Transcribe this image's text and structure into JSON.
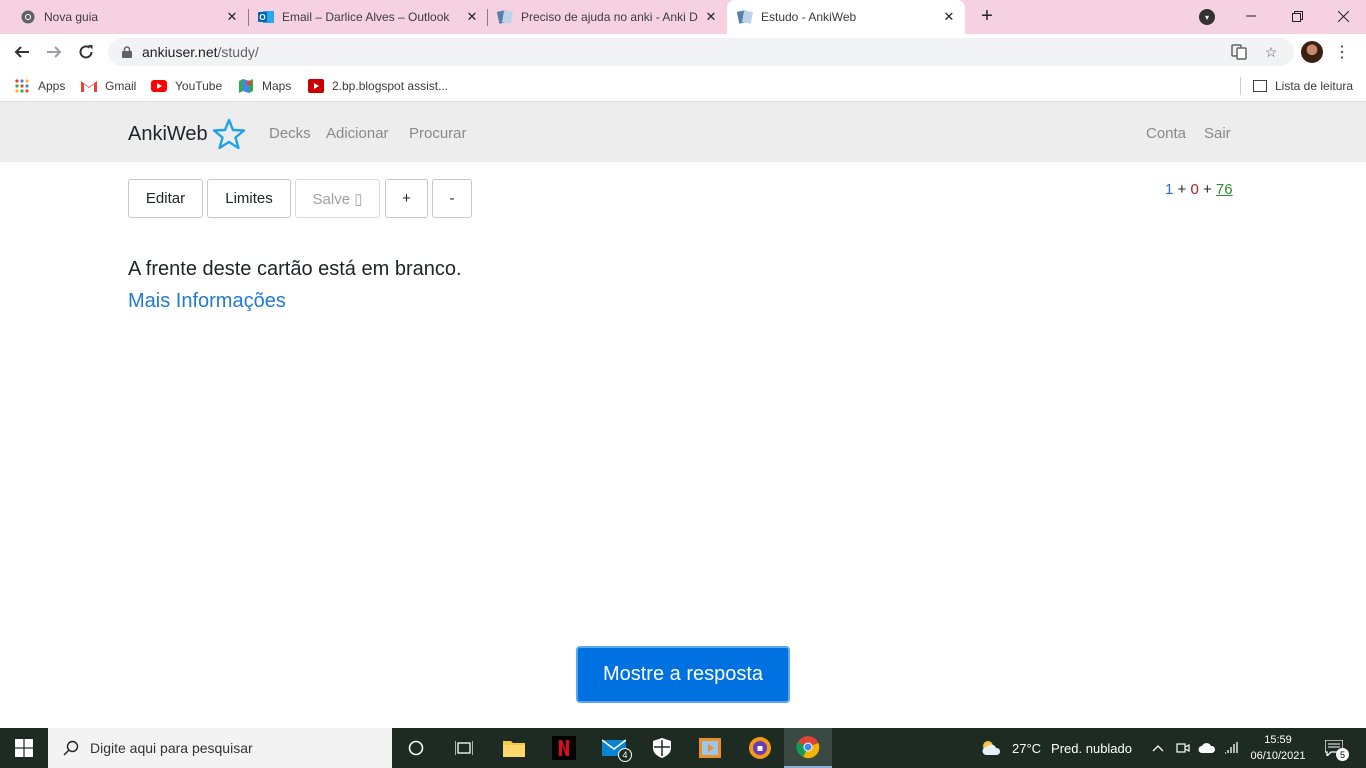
{
  "browser": {
    "tabs": [
      {
        "title": "Nova guia",
        "icon": "chrome-icon",
        "active": false
      },
      {
        "title": "Email – Darlice Alves – Outlook",
        "icon": "outlook-icon",
        "active": false
      },
      {
        "title": "Preciso de ajuda no anki - Anki D",
        "icon": "anki-icon",
        "active": false
      },
      {
        "title": "Estudo - AnkiWeb",
        "icon": "anki-icon",
        "active": true
      }
    ],
    "new_tab": "+",
    "close_glyph": "✕",
    "url_host": "ankiuser.net",
    "url_path": "/study/",
    "bookmarks": [
      {
        "label": "Apps",
        "icon": "apps-grid-icon"
      },
      {
        "label": "Gmail",
        "icon": "gmail-icon"
      },
      {
        "label": "YouTube",
        "icon": "youtube-icon"
      },
      {
        "label": "Maps",
        "icon": "maps-icon"
      },
      {
        "label": "2.bp.blogspot assist...",
        "icon": "youtube-icon"
      }
    ],
    "reading_list": "Lista de leitura"
  },
  "anki": {
    "brand": "AnkiWeb",
    "nav": {
      "decks": "Decks",
      "add": "Adicionar",
      "browse": "Procurar",
      "account": "Conta",
      "logout": "Sair"
    },
    "toolbar": {
      "edit": "Editar",
      "limits": "Limites",
      "save": "Salve ▯",
      "plus": "+",
      "minus": "-"
    },
    "counts": {
      "new": "1",
      "sep1": " + ",
      "learn": "0",
      "sep2": " + ",
      "review": "76"
    },
    "card_front": "A frente deste cartão está em branco.",
    "more_info": "Mais Informações",
    "show_answer": "Mostre a resposta",
    "colors": {
      "primary": "#0071e0",
      "nav_bg": "#ededed",
      "link": "#1f7ad9"
    }
  },
  "taskbar": {
    "search_placeholder": "Digite aqui para pesquisar",
    "weather_temp": "27°C",
    "weather_desc": "Pred. nublado",
    "time": "15:59",
    "date": "06/10/2021",
    "mail_badge": "4",
    "notification_badge": "5"
  }
}
